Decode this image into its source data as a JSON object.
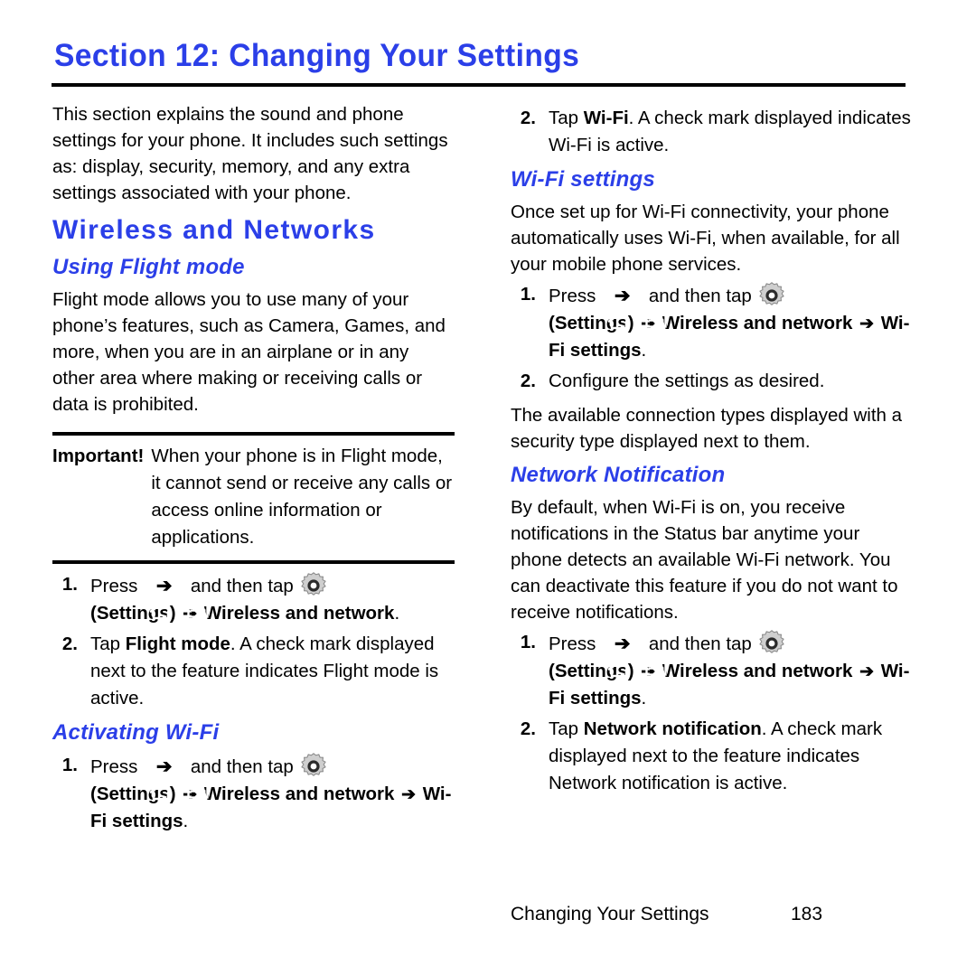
{
  "section": {
    "title": "Section 12: Changing Your Settings"
  },
  "left_column": {
    "intro": "This section explains the sound and phone settings for your phone. It includes such settings as: display, security, memory, and any extra settings associated with your phone.",
    "heading_main": "Wireless and Networks",
    "flight_heading": "Using Flight mode",
    "flight_body": "Flight mode allows you to use many of your phone’s features, such as Camera, Games, and more, when you are in an airplane or in any other area where making or receiving calls or data is prohibited.",
    "callout": {
      "label": "Important!",
      "text": "When your phone is in Flight mode, it cannot send or receive any calls or access online information or applications."
    },
    "flight_step1": {
      "number": "1.",
      "pre": "Press",
      "mid": "and then tap",
      "path_open": "(",
      "path_settings": "Settings",
      "path_close": ")",
      "path_tail": "Wireless and network",
      "path_period": "."
    },
    "flight_step2": {
      "number": "2.",
      "pre": "Tap ",
      "bold": "Flight mode",
      "post": ". A check mark displayed next to the feature indicates Flight mode is active."
    },
    "wifi_heading": "Activating Wi-Fi",
    "wifi_step1": {
      "number": "1.",
      "pre": "Press",
      "mid": "and then tap",
      "path_open": "(",
      "path_settings": "Settings",
      "path_close": ")",
      "path_mid": "Wireless and network",
      "path_tail": "Wi-Fi settings",
      "path_period": "."
    }
  },
  "right_column": {
    "wifi_step2": {
      "number": "2.",
      "pre": "Tap ",
      "bold": "Wi-Fi",
      "post": ". A check mark displayed indicates Wi-Fi is active."
    },
    "wifi_settings_heading": "Wi-Fi settings",
    "wifi_settings_body": "Once set up for Wi-Fi connectivity, your phone automatically uses Wi-Fi, when available, for all your mobile phone services.",
    "ws_step1": {
      "number": "1.",
      "pre": "Press",
      "mid": "and then tap",
      "path_open": "(",
      "path_settings": "Settings",
      "path_close": ")",
      "path_mid": "Wireless and network",
      "path_tail": "Wi-Fi settings",
      "path_period": "."
    },
    "ws_step2": {
      "number": "2.",
      "text": "Configure the settings as desired."
    },
    "ws_body2": "The available connection types displayed with a security type displayed next to them.",
    "netnotif_heading": "Network Notification",
    "netnotif_body": "By default, when Wi-Fi is on, you receive notifications in the Status bar anytime your phone detects an available Wi-Fi network. You can deactivate this feature if you do not want to receive notifications.",
    "nn_step1": {
      "number": "1.",
      "pre": "Press",
      "mid": "and then tap",
      "path_open": "(",
      "path_settings": "Settings",
      "path_close": ")",
      "path_mid": "Wireless and network",
      "path_tail": "Wi-Fi settings",
      "path_period": "."
    },
    "nn_step2": {
      "number": "2.",
      "pre": "Tap ",
      "bold": "Network notification",
      "post": ". A check mark displayed next to the feature indicates Network notification is active."
    }
  },
  "footer": {
    "title": "Changing Your Settings",
    "page": "183"
  },
  "icons": {
    "home": "home-key-icon",
    "menu": "menu-key-icon",
    "gear": "settings-gear-icon",
    "arrow": "➔"
  },
  "colors": {
    "heading_blue": "#2b3fe8",
    "text_black": "#000000",
    "icon_key_bg": "#000000",
    "gear_gray": "#c9c9c9"
  }
}
